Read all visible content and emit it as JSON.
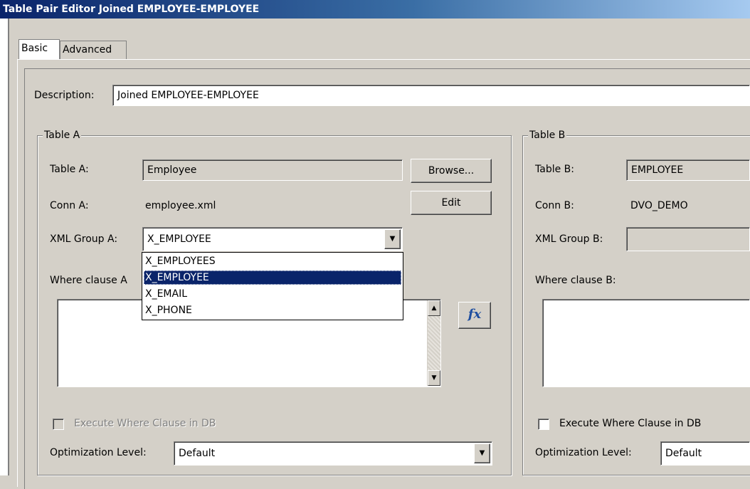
{
  "window": {
    "title": "Table Pair Editor Joined EMPLOYEE-EMPLOYEE"
  },
  "tabs": [
    {
      "label": "Basic",
      "active": true
    },
    {
      "label": "Advanced",
      "active": false
    }
  ],
  "description": {
    "label": "Description:",
    "value": "Joined EMPLOYEE-EMPLOYEE"
  },
  "table_a": {
    "group_title": "Table A",
    "table_label": "Table A:",
    "table_value": "Employee",
    "browse_label": "Browse...",
    "conn_label": "Conn A:",
    "conn_value": "employee.xml",
    "edit_label": "Edit",
    "xml_group_label": "XML Group A:",
    "xml_group_value": "X_EMPLOYEE",
    "xml_group_options": [
      "X_EMPLOYEES",
      "X_EMPLOYEE",
      "X_EMAIL",
      "X_PHONE"
    ],
    "xml_group_selected_index": 1,
    "where_label": "Where clause A",
    "where_value": "",
    "fx_label": "fx",
    "execute_where_label": "Execute Where Clause in DB",
    "execute_where_checked": false,
    "execute_where_enabled": false,
    "optimization_label": "Optimization Level:",
    "optimization_value": "Default"
  },
  "table_b": {
    "group_title": "Table B",
    "table_label": "Table B:",
    "table_value": "EMPLOYEE",
    "conn_label": "Conn B:",
    "conn_value": "DVO_DEMO",
    "xml_group_label": "XML Group B:",
    "xml_group_value": "",
    "where_label": "Where clause B:",
    "where_value": "",
    "execute_where_label": "Execute Where Clause in DB",
    "execute_where_checked": false,
    "optimization_label": "Optimization Level:",
    "optimization_value": "Default"
  },
  "icons": {
    "dropdown": "chevron-down-icon",
    "scroll_up": "arrow-up-icon",
    "scroll_down": "arrow-down-icon",
    "fx": "function-icon"
  },
  "colors": {
    "title_bar_start": "#0a246a",
    "title_bar_end": "#a6caf0",
    "dialog_bg": "#d4d0c8",
    "selection": "#0a246a"
  }
}
